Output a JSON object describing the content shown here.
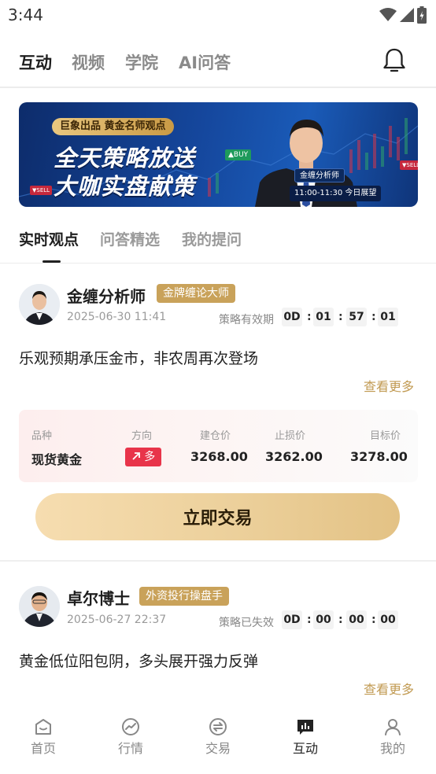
{
  "status_bar": {
    "time": "3:44"
  },
  "top_nav": {
    "tabs": [
      "互动",
      "视频",
      "学院",
      "AI问答"
    ],
    "active": 0
  },
  "banner": {
    "tag": "巨象出品 黄金名师观点",
    "line1": "全天策略放送",
    "line2": "大咖实盘献策",
    "analyst_badge": "金缠分析师",
    "schedule": "11:00-11:30 今日展望",
    "buy_label": "▲BUY",
    "sell_label": "▼SELL"
  },
  "sub_tabs": {
    "items": [
      "实时观点",
      "问答精选",
      "我的提问"
    ],
    "active": 0
  },
  "posts": [
    {
      "author": "金缠分析师",
      "title": "金牌缠论大师",
      "time": "2025-06-30 11:41",
      "validity_label": "策略有效期",
      "countdown": [
        "0D",
        "01",
        "57",
        "01"
      ],
      "content": "乐观预期承压金市，非农周再次登场",
      "more": "查看更多",
      "trade": {
        "labels": [
          "品种",
          "方向",
          "建仓价",
          "止损价",
          "目标价"
        ],
        "product": "现货黄金",
        "direction": "多",
        "entry": "3268.00",
        "stop": "3262.00",
        "target": "3278.00"
      },
      "trade_button": "立即交易"
    },
    {
      "author": "卓尔博士",
      "title": "外资投行操盘手",
      "time": "2025-06-27 22:37",
      "validity_label": "策略已失效",
      "countdown": [
        "0D",
        "00",
        "00",
        "00"
      ],
      "content": "黄金低位阳包阴，多头展开强力反弹",
      "more": "查看更多"
    }
  ],
  "bottom_nav": {
    "items": [
      "首页",
      "行情",
      "交易",
      "互动",
      "我的"
    ],
    "active": 3
  },
  "colors": {
    "gold": "#c9a25a",
    "red": "#e8344a",
    "trade_btn": "#ecd09b"
  }
}
